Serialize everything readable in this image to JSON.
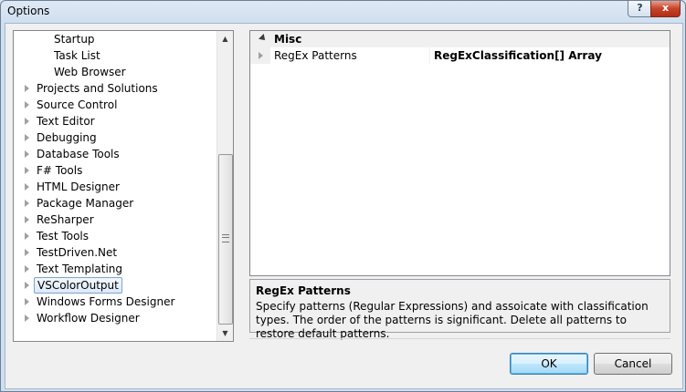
{
  "window": {
    "title": "Options",
    "help_glyph": "?",
    "close_glyph": "x"
  },
  "tree": {
    "items": [
      {
        "label": "Startup",
        "indent": "child",
        "expandable": false,
        "selected": false
      },
      {
        "label": "Task List",
        "indent": "child",
        "expandable": false,
        "selected": false
      },
      {
        "label": "Web Browser",
        "indent": "child",
        "expandable": false,
        "selected": false
      },
      {
        "label": "Projects and Solutions",
        "indent": "root",
        "expandable": true,
        "selected": false
      },
      {
        "label": "Source Control",
        "indent": "root",
        "expandable": true,
        "selected": false
      },
      {
        "label": "Text Editor",
        "indent": "root",
        "expandable": true,
        "selected": false
      },
      {
        "label": "Debugging",
        "indent": "root",
        "expandable": true,
        "selected": false
      },
      {
        "label": "Database Tools",
        "indent": "root",
        "expandable": true,
        "selected": false
      },
      {
        "label": "F# Tools",
        "indent": "root",
        "expandable": true,
        "selected": false
      },
      {
        "label": "HTML Designer",
        "indent": "root",
        "expandable": true,
        "selected": false
      },
      {
        "label": "Package Manager",
        "indent": "root",
        "expandable": true,
        "selected": false
      },
      {
        "label": "ReSharper",
        "indent": "root",
        "expandable": true,
        "selected": false
      },
      {
        "label": "Test Tools",
        "indent": "root",
        "expandable": true,
        "selected": false
      },
      {
        "label": "TestDriven.Net",
        "indent": "root",
        "expandable": true,
        "selected": false
      },
      {
        "label": "Text Templating",
        "indent": "root",
        "expandable": true,
        "selected": false
      },
      {
        "label": "VSColorOutput",
        "indent": "root",
        "expandable": true,
        "selected": true
      },
      {
        "label": "Windows Forms Designer",
        "indent": "root",
        "expandable": true,
        "selected": false
      },
      {
        "label": "Workflow Designer",
        "indent": "root",
        "expandable": true,
        "selected": false
      }
    ],
    "scroll_position": 0.75
  },
  "propgrid": {
    "category": "Misc",
    "properties": [
      {
        "name": "RegEx Patterns",
        "value": "RegExClassification[] Array"
      }
    ]
  },
  "description": {
    "title": "RegEx Patterns",
    "text": "Specify patterns (Regular Expressions) and assoicate with classification types. The order of the patterns is significant. Delete all patterns to restore default patterns."
  },
  "buttons": {
    "ok": "OK",
    "cancel": "Cancel"
  },
  "icons": {
    "tree_expand": "triangle-right-icon",
    "category_collapse": "triangle-down-icon",
    "scroll_up": "arrow-up-icon",
    "scroll_down": "arrow-down-icon"
  }
}
